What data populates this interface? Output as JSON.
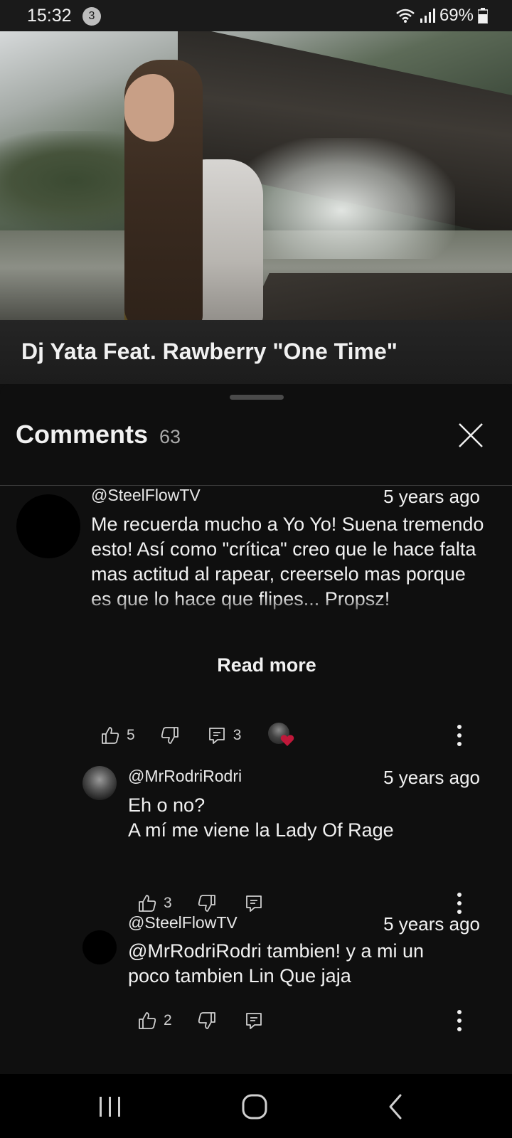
{
  "status_bar": {
    "time": "15:32",
    "notification_count": "3",
    "battery": "69%"
  },
  "video": {
    "title": "Dj Yata Feat. Rawberry \"One Time\""
  },
  "comments": {
    "title": "Comments",
    "count": "63",
    "read_more_label": "Read more",
    "items": [
      {
        "author": "@SteelFlowTV",
        "time_ago": "5 years ago",
        "text": "Me recuerda mucho a Yo Yo! Suena tremendo esto! Así como \"crítica\" creo que le hace falta mas actitud al rapear, creerselo mas porque es que lo hace que flipes... Propsz!",
        "likes": "5",
        "replies": "3"
      },
      {
        "author": "@MrRodriRodri",
        "time_ago": "5 years ago",
        "text_line1": "Eh o no?",
        "text_line2": "A mí me viene la Lady Of Rage",
        "likes": "3"
      },
      {
        "author": "@SteelFlowTV",
        "time_ago": "5 years ago",
        "text": "@MrRodriRodri tambien! y a mi un poco tambien Lin Que  jaja",
        "likes": "2"
      }
    ]
  },
  "colors": {
    "background": "#0f0f0f",
    "heart": "#c0183a"
  },
  "icons": [
    "wifi-icon",
    "signal-icon",
    "battery-icon",
    "close-icon",
    "thumbs-up-icon",
    "thumbs-down-icon",
    "reply-icon",
    "heart-icon",
    "more-options-icon",
    "recents-icon",
    "home-icon",
    "back-icon"
  ]
}
